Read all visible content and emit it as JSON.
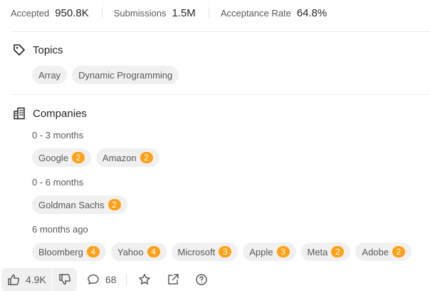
{
  "stats": {
    "accepted_label": "Accepted",
    "accepted_value": "950.8K",
    "submissions_label": "Submissions",
    "submissions_value": "1.5M",
    "acceptance_label": "Acceptance Rate",
    "acceptance_value": "64.8%"
  },
  "topics": {
    "title": "Topics",
    "icon": "tag-icon",
    "items": [
      "Array",
      "Dynamic Programming"
    ]
  },
  "companies": {
    "title": "Companies",
    "icon": "building-icon",
    "groups": [
      {
        "period": "0 - 3 months",
        "items": [
          {
            "name": "Google",
            "count": "2"
          },
          {
            "name": "Amazon",
            "count": "2"
          }
        ]
      },
      {
        "period": "0 - 6 months",
        "items": [
          {
            "name": "Goldman Sachs",
            "count": "2"
          }
        ]
      },
      {
        "period": "6 months ago",
        "items": [
          {
            "name": "Bloomberg",
            "count": "4"
          },
          {
            "name": "Yahoo",
            "count": "4"
          },
          {
            "name": "Microsoft",
            "count": "3"
          },
          {
            "name": "Apple",
            "count": "3"
          },
          {
            "name": "Meta",
            "count": "2"
          },
          {
            "name": "Adobe",
            "count": "2"
          }
        ]
      }
    ]
  },
  "toolbar": {
    "likes": "4.9K",
    "comments": "68",
    "icons": [
      "thumbs-up-icon",
      "thumbs-down-icon",
      "comment-icon",
      "star-icon",
      "share-icon",
      "help-icon"
    ]
  },
  "colors": {
    "badge": "#ffa116",
    "chip_bg": "#f0f0f0",
    "muted_text": "#595959"
  }
}
